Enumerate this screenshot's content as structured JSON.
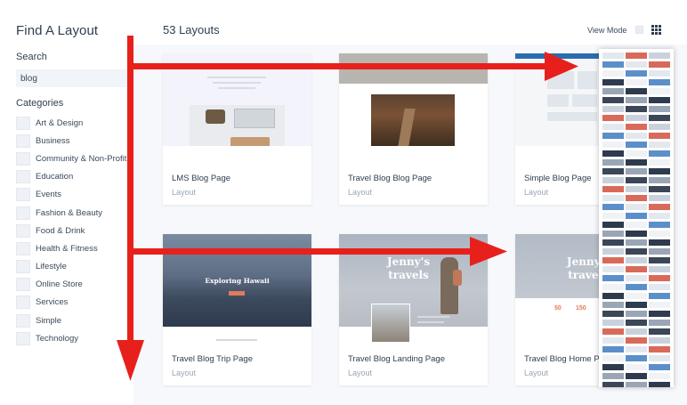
{
  "sidebar": {
    "title": "Find A Layout",
    "search_label": "Search",
    "search_value": "blog",
    "categories_label": "Categories",
    "categories": [
      "Art & Design",
      "Business",
      "Community & Non-Profit",
      "Education",
      "Events",
      "Fashion & Beauty",
      "Food & Drink",
      "Health & Fitness",
      "Lifestyle",
      "Online Store",
      "Services",
      "Simple",
      "Technology"
    ]
  },
  "main": {
    "count_title": "53 Layouts",
    "view_mode_label": "View Mode",
    "cards": [
      {
        "title": "LMS Blog Page",
        "type": "Layout"
      },
      {
        "title": "Travel Blog Blog Page",
        "type": "Layout"
      },
      {
        "title": "Simple Blog Page",
        "type": "Layout"
      },
      {
        "title": "Travel Blog Trip Page",
        "type": "Layout"
      },
      {
        "title": "Travel Blog Landing Page",
        "type": "Layout"
      },
      {
        "title": "Travel Blog Home Pa",
        "type": "Layout"
      }
    ],
    "thumb_text": {
      "hawaii": "Exploring Hawaii",
      "jenny": "Jenny's travels",
      "jenny2": "Jenny's travels",
      "stat1": "50",
      "stat2": "150"
    }
  },
  "colors": {
    "arrow": "#e8201c",
    "accent": "#2b6cb0",
    "title_text": "#2f3e50",
    "muted_text": "#9aa6b5"
  }
}
